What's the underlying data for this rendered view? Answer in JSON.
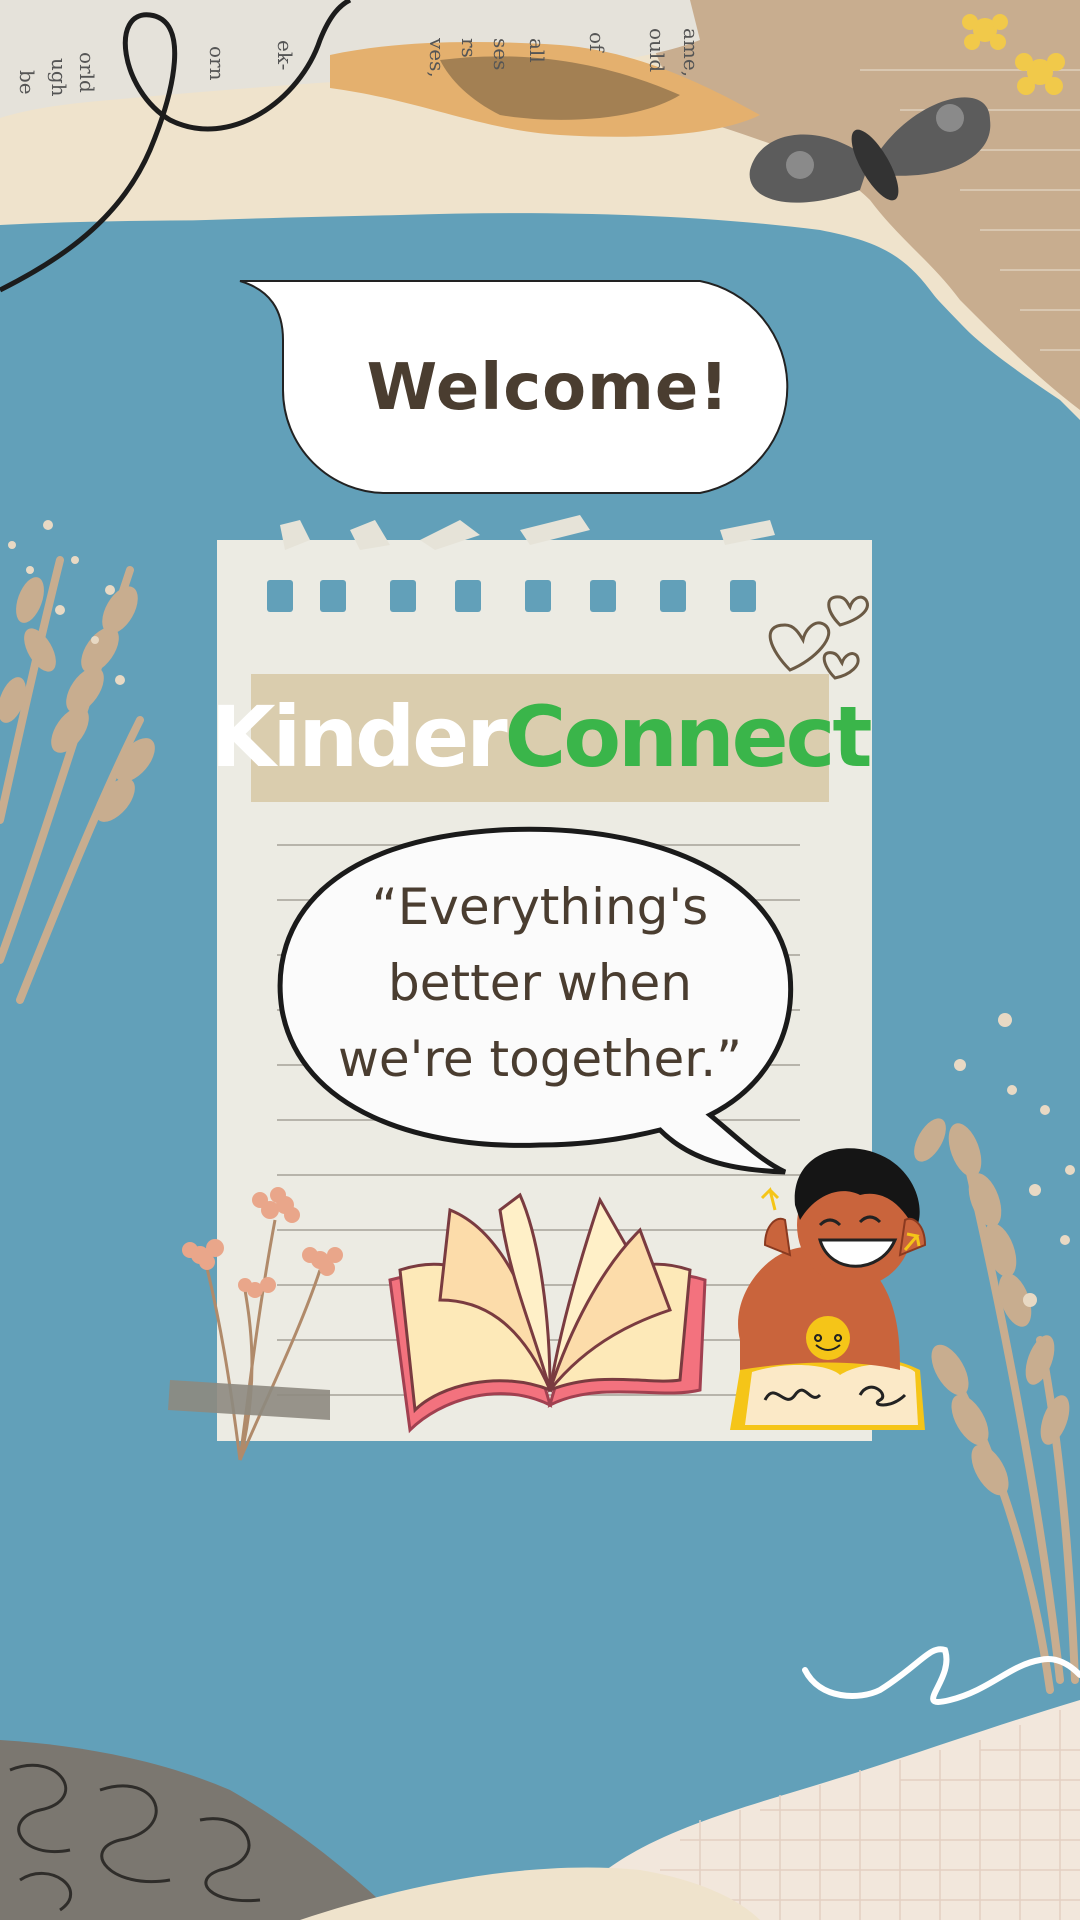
{
  "welcome": {
    "text": "Welcome!"
  },
  "brand": {
    "part1": "Kinder",
    "part2": "Connect"
  },
  "quote": {
    "text": "“Everything's\nbetter when\nwe're together.”"
  },
  "colors": {
    "background": "#62a0b9",
    "paper": "#ecebe3",
    "brand_band": "#dacdae",
    "brand_connect": "#3ab54a",
    "text_dark": "#4a3d30"
  }
}
